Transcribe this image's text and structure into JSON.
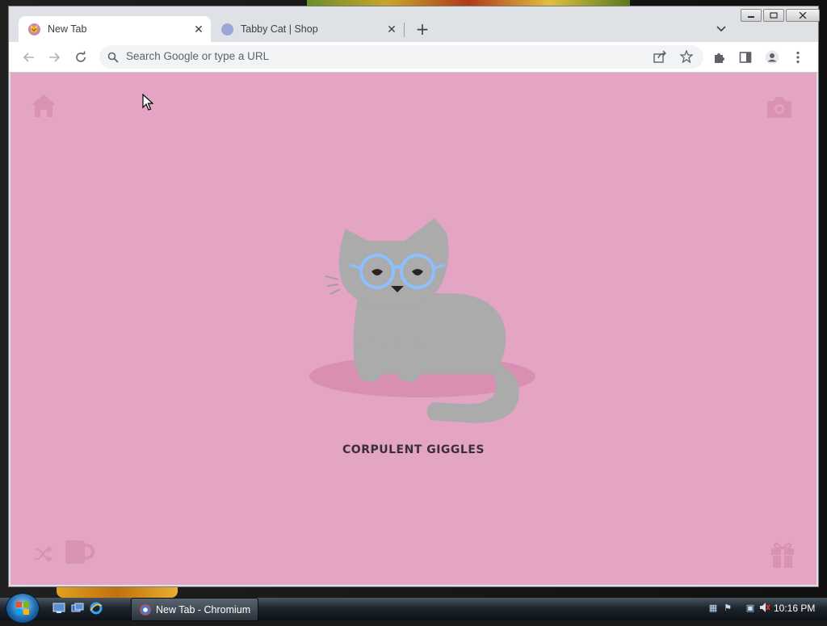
{
  "browser": {
    "tabs": [
      {
        "title": "New Tab",
        "active": true
      },
      {
        "title": "Tabby Cat | Shop",
        "active": false
      }
    ],
    "omnibox": {
      "placeholder": "Search Google or type a URL"
    }
  },
  "page": {
    "background_color": "#e4a5c4",
    "cat_name": "CORPULENT GIGGLES",
    "icons": [
      "home-icon",
      "camera-icon",
      "shuffle-icon",
      "mug-icon",
      "gift-icon"
    ]
  },
  "taskbar": {
    "active_window_title": "New Tab - Chromium",
    "clock": "10:16 PM"
  }
}
